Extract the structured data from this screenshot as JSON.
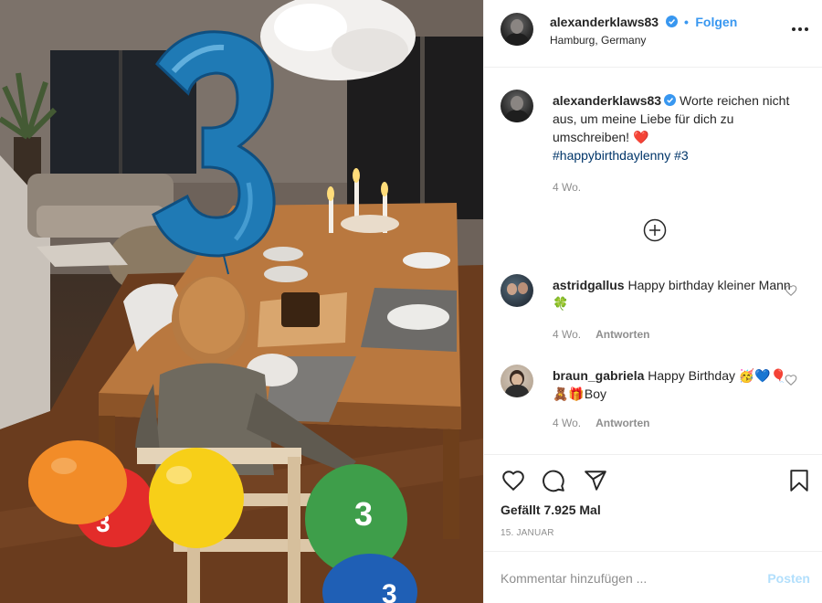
{
  "post": {
    "author": "alexanderklaws83",
    "follow_label": "Folgen",
    "separator": "•",
    "location": "Hamburg, Germany",
    "caption_text": "Worte reichen nicht aus, um meine Liebe für dich zu umschreiben!",
    "caption_emoji": "❤️",
    "hashtags": "#happybirthdaylenny #3",
    "caption_age": "4 Wo.",
    "photo_balloon_number": "3",
    "balloon_numbers": [
      "3",
      "3",
      "3"
    ]
  },
  "comments": [
    {
      "username": "astridgallus",
      "text": "Happy birthday kleiner Mann 🍀",
      "age": "4 Wo.",
      "reply_label": "Antworten"
    },
    {
      "username": "braun_gabriela",
      "text": "Happy Birthday 🥳💙🎈🧸🎁Boy",
      "age": "4 Wo.",
      "reply_label": "Antworten"
    }
  ],
  "stats": {
    "likes": "Gefällt 7.925 Mal",
    "date": "15. JANUAR"
  },
  "composer": {
    "placeholder": "Kommentar hinzufügen ...",
    "post_label": "Posten"
  },
  "colors": {
    "link": "#3897f0",
    "hashtag": "#003569",
    "muted": "#8e8e8e",
    "post_disabled": "#b2dffc",
    "balloon_blue": "#1e7bb8"
  },
  "icons": [
    "verified-badge-icon",
    "more-options-icon",
    "heart-outline-icon",
    "add-circle-icon",
    "comment-icon",
    "share-icon",
    "bookmark-icon"
  ]
}
